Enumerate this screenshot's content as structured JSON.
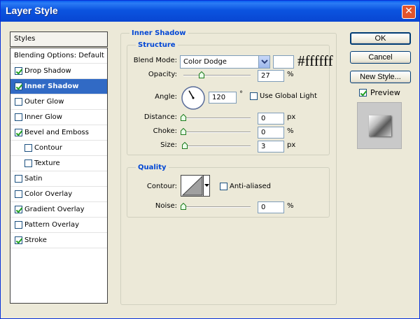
{
  "window": {
    "title": "Layer Style",
    "close_glyph": "✕"
  },
  "styles_panel": {
    "header": "Styles",
    "items": [
      {
        "label": "Blending Options: Default"
      },
      {
        "label": "Drop Shadow",
        "checked": true
      },
      {
        "label": "Inner Shadow",
        "checked": true,
        "selected": true
      },
      {
        "label": "Outer Glow",
        "checked": false
      },
      {
        "label": "Inner Glow",
        "checked": false
      },
      {
        "label": "Bevel and Emboss",
        "checked": true
      },
      {
        "label": "Contour",
        "checked": false
      },
      {
        "label": "Texture",
        "checked": false
      },
      {
        "label": "Satin",
        "checked": false
      },
      {
        "label": "Color Overlay",
        "checked": false
      },
      {
        "label": "Gradient Overlay",
        "checked": true
      },
      {
        "label": "Pattern Overlay",
        "checked": false
      },
      {
        "label": "Stroke",
        "checked": true
      }
    ]
  },
  "inner_shadow": {
    "title": "Inner Shadow",
    "structure": {
      "title": "Structure",
      "blend_mode_label": "Blend Mode:",
      "blend_mode_value": "Color Dodge",
      "color_hex": "#ffffff",
      "color_caption": "#ffffff",
      "opacity_label": "Opacity:",
      "opacity_value": "27",
      "opacity_fraction": 0.27,
      "angle_label": "Angle:",
      "angle_value": "120",
      "angle_deg": 120,
      "degree_symbol": "°",
      "use_global_light_label": "Use Global Light",
      "use_global_light": false,
      "distance_label": "Distance:",
      "distance_value": "0",
      "distance_fraction": 0,
      "choke_label": "Choke:",
      "choke_value": "0",
      "choke_fraction": 0,
      "size_label": "Size:",
      "size_value": "3",
      "size_fraction": 0.02,
      "unit_px": "px",
      "unit_pct": "%"
    },
    "quality": {
      "title": "Quality",
      "contour_label": "Contour:",
      "anti_aliased_label": "Anti-aliased",
      "anti_aliased": false,
      "noise_label": "Noise:",
      "noise_value": "0",
      "noise_fraction": 0,
      "unit_pct": "%"
    }
  },
  "buttons": {
    "ok": "OK",
    "cancel": "Cancel",
    "new_style": "New Style...",
    "preview_label": "Preview",
    "preview_checked": true
  },
  "colors": {
    "title_bar": "#0a5ef0",
    "selection": "#316ac5",
    "legend": "#0046d5",
    "dialog_bg": "#ece9d8"
  }
}
